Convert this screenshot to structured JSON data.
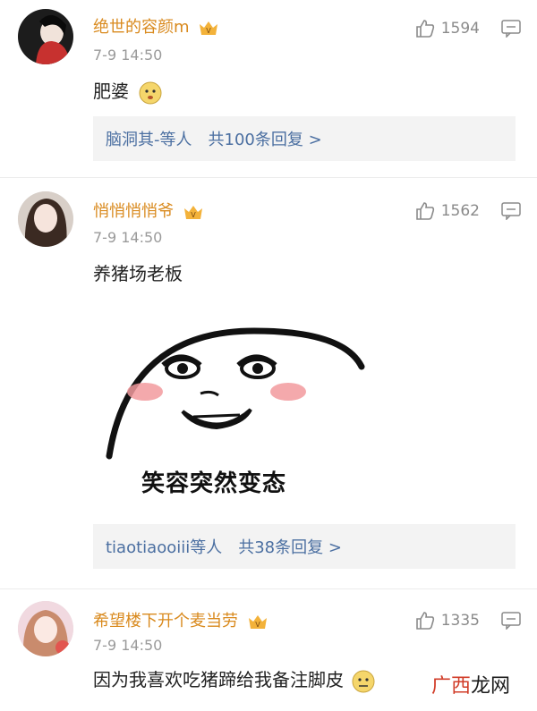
{
  "comments": [
    {
      "username": "绝世的容颜m",
      "time": "7-9 14:50",
      "text": "肥婆",
      "likes": "1594",
      "replies_users": "脑洞其-等人",
      "replies_count": "共100条回复 >"
    },
    {
      "username": "悄悄悄悄爷",
      "time": "7-9 14:50",
      "text": "养猪场老板",
      "meme_caption": "笑容突然变态",
      "likes": "1562",
      "replies_users": "tiaotiaooiii等人",
      "replies_count": "共38条回复 >"
    },
    {
      "username": "希望楼下开个麦当劳",
      "time": "7-9 14:50",
      "text": "因为我喜欢吃猪蹄给我备注脚皮",
      "likes": "1335"
    }
  ],
  "watermark": {
    "part1": "广西",
    "part2": "龙网"
  },
  "colors": {
    "username": "#d98a1e",
    "link": "#4b6fa1",
    "time": "#9a9a9a"
  }
}
